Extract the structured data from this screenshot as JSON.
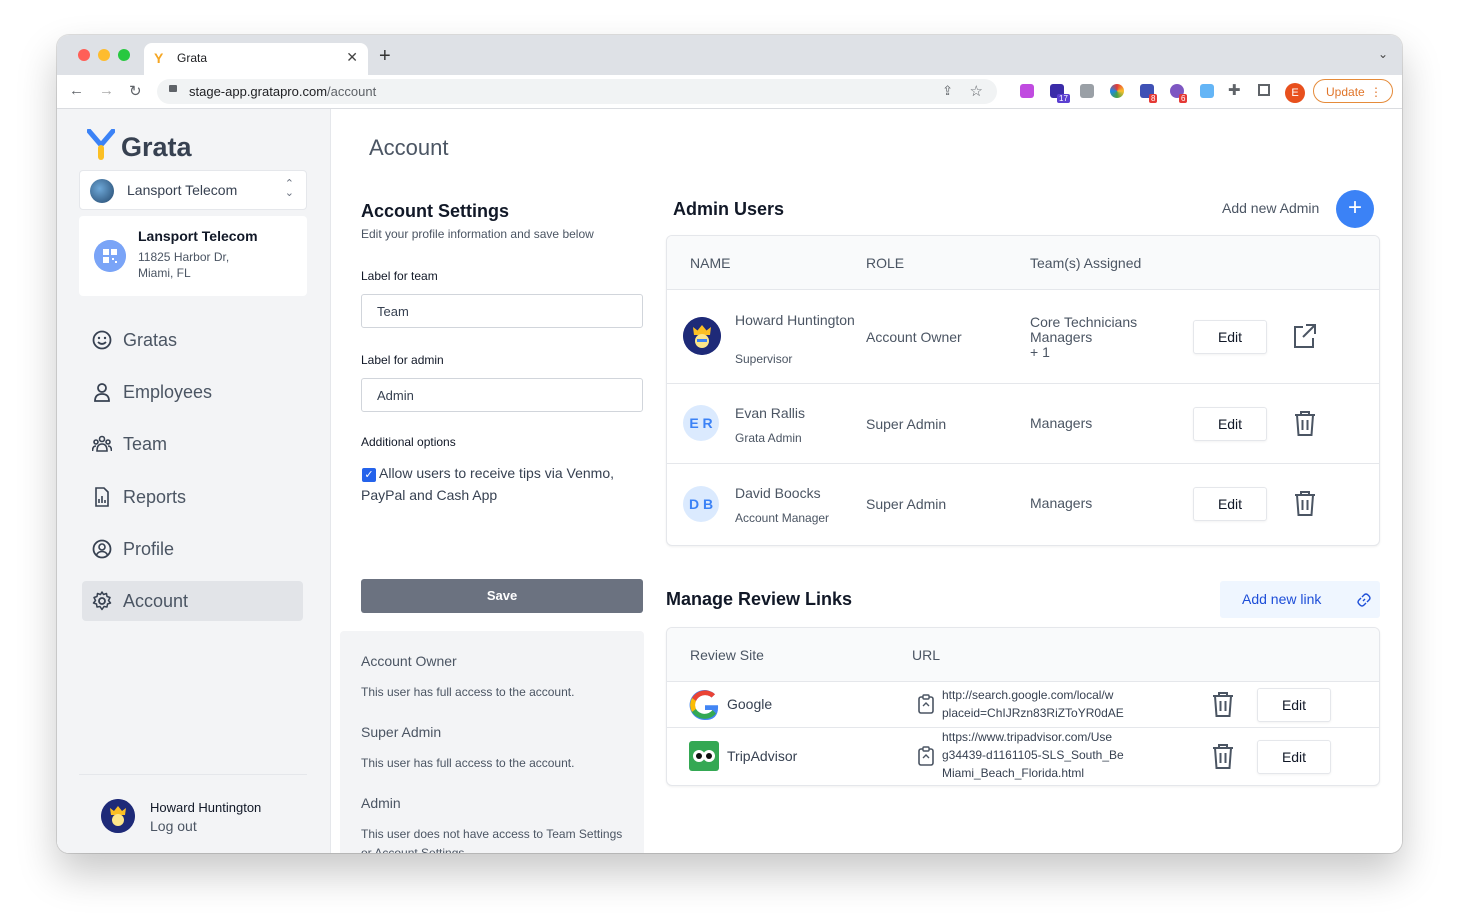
{
  "browser": {
    "tab_title": "Grata",
    "url_host": "stage-app.gratapro.com",
    "url_path": "/account",
    "profile_initial": "E",
    "update_label": "Update",
    "ext_badges": [
      "17",
      "8",
      "6"
    ]
  },
  "sidebar": {
    "logo_text": "Grata",
    "org_select": "Lansport Telecom",
    "org_card": {
      "name": "Lansport Telecom",
      "address_line1": "11825 Harbor Dr,",
      "address_line2": "Miami, FL"
    },
    "nav": [
      {
        "label": "Gratas",
        "icon": "smile-icon"
      },
      {
        "label": "Employees",
        "icon": "user-icon"
      },
      {
        "label": "Team",
        "icon": "team-icon"
      },
      {
        "label": "Reports",
        "icon": "report-icon"
      },
      {
        "label": "Profile",
        "icon": "profile-icon"
      },
      {
        "label": "Account",
        "icon": "gear-icon",
        "active": true
      }
    ],
    "user_name": "Howard Huntington",
    "logout_label": "Log out"
  },
  "main": {
    "page_title": "Account",
    "settings": {
      "title": "Account Settings",
      "subtitle": "Edit your profile information and save below",
      "team_label": "Label for team",
      "team_value": "Team",
      "admin_label": "Label for admin",
      "admin_value": "Admin",
      "options_label": "Additional options",
      "tips_option": "Allow users to receive tips via Venmo, PayPal and Cash App",
      "tips_checked": true,
      "save_label": "Save"
    },
    "roles": [
      {
        "name": "Account Owner",
        "description": "This user has full access to the account."
      },
      {
        "name": "Super Admin",
        "description": "This user has full access to the account."
      },
      {
        "name": "Admin",
        "description": "This user does not have access to Team Settings or Account Settings."
      }
    ],
    "admin_users": {
      "title": "Admin Users",
      "add_label": "Add new Admin",
      "columns": [
        "NAME",
        "ROLE",
        "Team(s) Assigned"
      ],
      "rows": [
        {
          "name": "Howard Huntington",
          "subtitle": "Supervisor",
          "role": "Account Owner",
          "teams": "Core Technicians",
          "teams2": "Managers",
          "teams3": "+ 1",
          "avatar": "crest",
          "action": "external-link-icon"
        },
        {
          "name": "Evan Rallis",
          "subtitle": "Grata Admin",
          "role": "Super Admin",
          "teams": "Managers",
          "initials": "E R",
          "action": "trash-icon"
        },
        {
          "name": "David Boocks",
          "subtitle": "Account Manager",
          "role": "Super Admin",
          "teams": "Managers",
          "initials": "D B",
          "action": "trash-icon"
        }
      ],
      "edit_label": "Edit"
    },
    "review_links": {
      "title": "Manage Review Links",
      "add_label": "Add new link",
      "columns": [
        "Review Site",
        "URL"
      ],
      "rows": [
        {
          "site": "Google",
          "url_lines": [
            "http://search.google.com/local/w",
            "placeid=ChIJRzn83RiZToYR0dAE"
          ]
        },
        {
          "site": "TripAdvisor",
          "url_lines": [
            "https://www.tripadvisor.com/Use",
            "g34439-d1161105-SLS_South_Be",
            "Miami_Beach_Florida.html"
          ]
        }
      ],
      "edit_label": "Edit"
    }
  },
  "colors": {
    "accent": "#3b82f6",
    "save_button": "#6b7280",
    "sidebar_bg": "#f3f4f6"
  }
}
